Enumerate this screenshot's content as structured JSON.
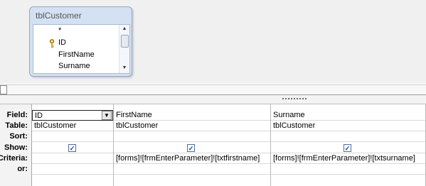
{
  "table": {
    "name": "tblCustomer",
    "fields": [
      "*",
      "ID",
      "FirstName",
      "Surname"
    ]
  },
  "grid": {
    "row_labels": [
      "Field:",
      "Table:",
      "Sort:",
      "Show:",
      "Criteria:",
      "or:"
    ],
    "columns": [
      {
        "field": "ID",
        "table": "tblCustomer",
        "sort": "",
        "show": true,
        "criteria": "",
        "or": ""
      },
      {
        "field": "FirstName",
        "table": "tblCustomer",
        "sort": "",
        "show": true,
        "criteria": "[forms]![frmEnterParameter]![txtfirstname]",
        "or": ""
      },
      {
        "field": "Surname",
        "table": "tblCustomer",
        "sort": "",
        "show": true,
        "criteria": "[forms]![frmEnterParameter]![txtsurname]",
        "or": ""
      }
    ]
  }
}
